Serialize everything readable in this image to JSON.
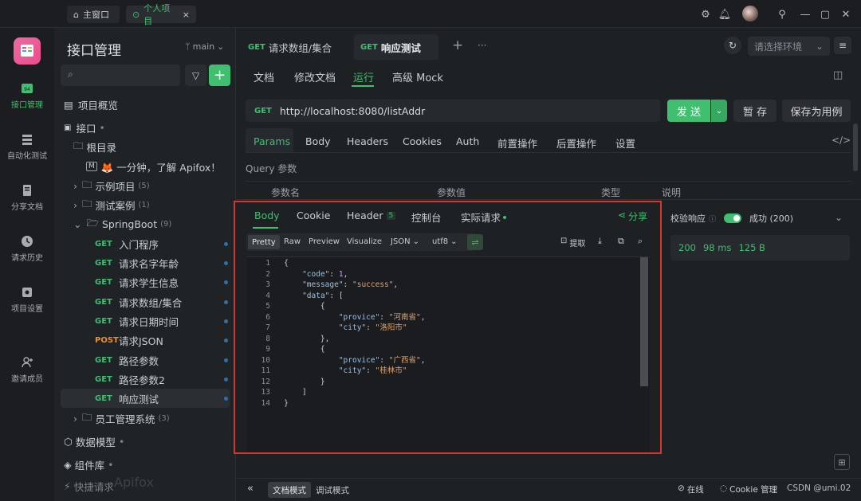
{
  "titlebar": {
    "home_tab": "主窗口",
    "project_tab": "个人项目",
    "close": "×"
  },
  "rail": {
    "items": [
      "接口管理",
      "自动化测试",
      "分享文档",
      "请求历史",
      "项目设置",
      "邀请成员"
    ]
  },
  "sidebar": {
    "title": "接口管理",
    "branch": "main",
    "search_placeholder": "",
    "items": [
      {
        "label": "项目概览"
      },
      {
        "label": "接口",
        "suffix": "•"
      },
      {
        "label": "根目录"
      },
      {
        "label": "🦊 一分钟，了解 Apifox！",
        "badge": "M"
      },
      {
        "label": "示例项目",
        "count": "(5)"
      },
      {
        "label": "测试案例",
        "count": "(1)"
      },
      {
        "label": "SpringBoot",
        "count": "(9)"
      }
    ],
    "endpoints": [
      {
        "method": "GET",
        "name": "入门程序"
      },
      {
        "method": "GET",
        "name": "请求名字年龄"
      },
      {
        "method": "GET",
        "name": "请求学生信息"
      },
      {
        "method": "GET",
        "name": "请求数组/集合"
      },
      {
        "method": "GET",
        "name": "请求日期时间"
      },
      {
        "method": "POST",
        "name": "请求JSON"
      },
      {
        "method": "GET",
        "name": "路径参数"
      },
      {
        "method": "GET",
        "name": "路径参数2"
      },
      {
        "method": "GET",
        "name": "响应测试"
      }
    ],
    "employee_folder": {
      "label": "员工管理系统",
      "count": "(3)"
    },
    "data_model": "数据模型",
    "components": "组件库",
    "quick_req": "快捷请求",
    "watermark": "Apifox"
  },
  "main": {
    "tabs": [
      {
        "method": "GET",
        "label": "请求数组/集合"
      },
      {
        "method": "GET",
        "label": "响应测试"
      }
    ],
    "add": "+",
    "more": "···",
    "env_placeholder": "请选择环境",
    "subtabs": [
      "文档",
      "修改文档",
      "运行",
      "高级 Mock"
    ],
    "method": "GET",
    "url": "http://localhost:8080/listAddr",
    "send": "发 送",
    "save": "暂 存",
    "save_case": "保存为用例",
    "req_tabs": [
      "Params",
      "Body",
      "Headers",
      "Cookies",
      "Auth",
      "前置操作",
      "后置操作",
      "设置"
    ],
    "query_label": "Query 参数",
    "cols": [
      "参数名",
      "参数值",
      "类型",
      "说明"
    ]
  },
  "response": {
    "tabs": [
      "Body",
      "Cookie",
      "Header",
      "控制台",
      "实际请求"
    ],
    "header_count": "5",
    "share": "分享",
    "views": [
      "Pretty",
      "Raw",
      "Preview",
      "Visualize"
    ],
    "format": "JSON",
    "encoding": "utf8",
    "extract": "提取",
    "code": [
      "{",
      "    \"code\": 1,",
      "    \"message\": \"success\",",
      "    \"data\": [",
      "        {",
      "            \"provice\": \"河南省\",",
      "            \"city\": \"洛阳市\"",
      "        },",
      "        {",
      "            \"provice\": \"广西省\",",
      "            \"city\": \"桂林市\"",
      "        }",
      "    ]",
      "}"
    ]
  },
  "validation": {
    "label": "校验响应",
    "status": "成功 (200)",
    "code": "200",
    "time": "98 ms",
    "size": "125 B"
  },
  "footer": {
    "doc_mode": "文档模式",
    "debug_mode": "调试模式",
    "online": "在线",
    "cookie": "Cookie 管理",
    "csdn": "CSDN @umi.02"
  },
  "colors": {
    "accent_green": "#3fbf6f",
    "post_orange": "#e8902b",
    "highlight_red": "#d8352f"
  }
}
